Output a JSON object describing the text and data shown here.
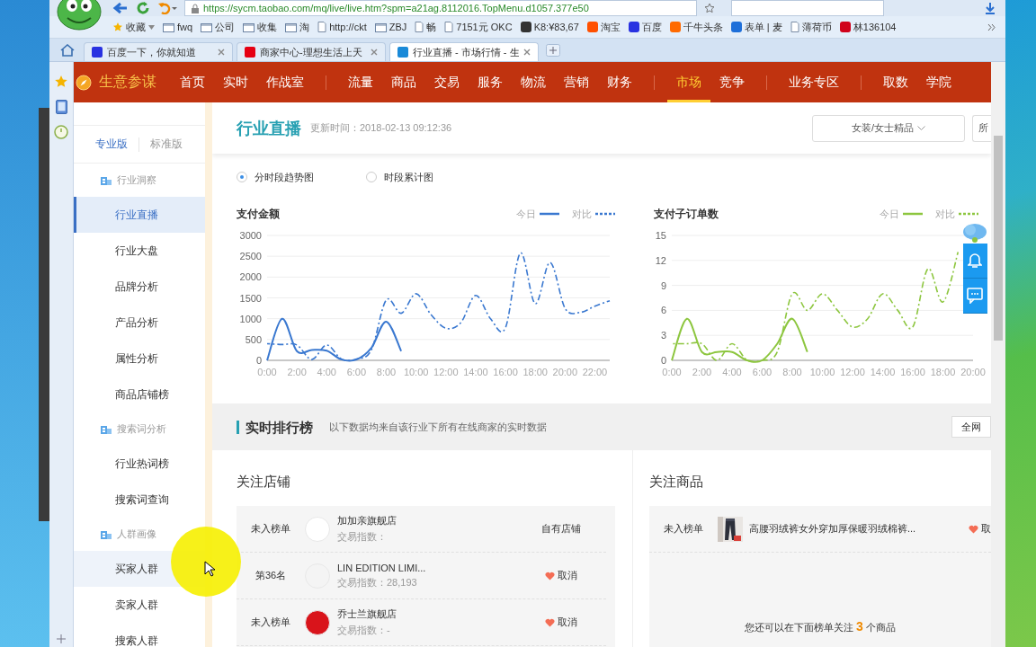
{
  "browser": {
    "address": "https://sycm.taobao.com/mq/live/live.htm?spm=a21ag.8112016.TopMenu.d1057.377e50",
    "bookmarks": [
      {
        "label": "收藏",
        "kind": "star"
      },
      {
        "label": "fwq",
        "kind": "folder"
      },
      {
        "label": "公司",
        "kind": "folder"
      },
      {
        "label": "收集",
        "kind": "folder"
      },
      {
        "label": "淘",
        "kind": "folder"
      },
      {
        "label": "http://ckt",
        "kind": "page"
      },
      {
        "label": "ZBJ",
        "kind": "folder"
      },
      {
        "label": "畅",
        "kind": "page"
      },
      {
        "label": "7151元 OKC",
        "kind": "page"
      },
      {
        "label": "K8:¥83,67",
        "kind": "logo",
        "color": "#333333"
      },
      {
        "label": "淘宝",
        "kind": "logo",
        "color": "#ff5000"
      },
      {
        "label": "百度",
        "kind": "logo",
        "color": "#2932e1"
      },
      {
        "label": "千牛头条",
        "kind": "logo",
        "color": "#ff6a00"
      },
      {
        "label": "表单 | 麦",
        "kind": "logo",
        "color": "#1e6fd9"
      },
      {
        "label": "薄荷币",
        "kind": "page"
      },
      {
        "label": "林136104",
        "kind": "logo",
        "color": "#d0021b"
      }
    ],
    "tabs": [
      {
        "title": "百度一下，你就知道",
        "color": "#2932e1",
        "selected": false
      },
      {
        "title": "商家中心-理想生活上天",
        "color": "#e60012",
        "selected": false
      },
      {
        "title": "行业直播 - 市场行情 - 生",
        "color": "#1a8ad8",
        "selected": true
      }
    ]
  },
  "nav": {
    "brand": "生意参谋",
    "groups": [
      [
        {
          "label": "首页",
          "selected": false
        },
        {
          "label": "实时",
          "selected": false
        },
        {
          "label": "作战室",
          "selected": false
        }
      ],
      [
        {
          "label": "流量",
          "selected": false
        },
        {
          "label": "商品",
          "selected": false
        },
        {
          "label": "交易",
          "selected": false
        },
        {
          "label": "服务",
          "selected": false
        },
        {
          "label": "物流",
          "selected": false
        },
        {
          "label": "营销",
          "selected": false
        },
        {
          "label": "财务",
          "selected": false
        }
      ],
      [
        {
          "label": "市场",
          "selected": true
        },
        {
          "label": "竞争",
          "selected": false
        }
      ],
      [
        {
          "label": "业务专区",
          "selected": false
        }
      ],
      [
        {
          "label": "取数",
          "selected": false
        },
        {
          "label": "学院",
          "selected": false
        }
      ]
    ]
  },
  "sidebar": {
    "versions": [
      {
        "label": "专业版",
        "selected": true
      },
      {
        "label": "标准版",
        "selected": false
      }
    ],
    "sections": [
      {
        "title": "行业洞察",
        "items": [
          {
            "label": "行业直播",
            "selected": true,
            "hovered": false
          },
          {
            "label": "行业大盘",
            "selected": false,
            "hovered": false
          },
          {
            "label": "品牌分析",
            "selected": false,
            "hovered": false
          },
          {
            "label": "产品分析",
            "selected": false,
            "hovered": false
          },
          {
            "label": "属性分析",
            "selected": false,
            "hovered": false
          },
          {
            "label": "商品店铺榜",
            "selected": false,
            "hovered": false
          }
        ]
      },
      {
        "title": "搜索词分析",
        "items": [
          {
            "label": "行业热词榜",
            "selected": false,
            "hovered": false
          },
          {
            "label": "搜索词查询",
            "selected": false,
            "hovered": false
          }
        ]
      },
      {
        "title": "人群画像",
        "items": [
          {
            "label": "买家人群",
            "selected": false,
            "hovered": true
          },
          {
            "label": "卖家人群",
            "selected": false,
            "hovered": false
          },
          {
            "label": "搜索人群",
            "selected": false,
            "hovered": false
          }
        ]
      }
    ]
  },
  "header": {
    "title": "行业直播",
    "updated": "更新时间：2018-02-13 09:12:36",
    "category": "女装/女士精品",
    "button_2": "所"
  },
  "views": [
    {
      "label": "分时段趋势图",
      "selected": true
    },
    {
      "label": "时段累计图",
      "selected": false
    }
  ],
  "charts": [
    {
      "title": "支付金额",
      "chart_data": {
        "type": "line",
        "grid": true,
        "legend": true,
        "x": [
          0,
          1,
          2,
          3,
          4,
          5,
          6,
          7,
          8,
          9,
          10,
          11,
          12,
          13,
          14,
          15,
          16,
          17,
          18,
          19,
          20,
          21,
          22,
          23
        ],
        "xlim": [
          0,
          23
        ],
        "ylim": [
          0,
          3000
        ],
        "xticks": [
          {
            "value": 0,
            "label": "0:00"
          },
          {
            "value": 2,
            "label": "2:00"
          },
          {
            "value": 4,
            "label": "4:00"
          },
          {
            "value": 6,
            "label": "6:00"
          },
          {
            "value": 8,
            "label": "8:00"
          },
          {
            "value": 10,
            "label": "10:00"
          },
          {
            "value": 12,
            "label": "12:00"
          },
          {
            "value": 14,
            "label": "14:00"
          },
          {
            "value": 16,
            "label": "16:00"
          },
          {
            "value": 18,
            "label": "18:00"
          },
          {
            "value": 20,
            "label": "20:00"
          },
          {
            "value": 22,
            "label": "22:00"
          }
        ],
        "yticks": [
          0,
          500,
          1000,
          1500,
          2000,
          2500,
          3000
        ],
        "series": [
          {
            "name": "今日",
            "color": "#3a78d0",
            "line_style": "solid",
            "values": [
              0,
              1000,
              220,
              250,
              230,
              20,
              20,
              300,
              930,
              220,
              null,
              null,
              null,
              null,
              null,
              null,
              null,
              null,
              null,
              null,
              null,
              null,
              null,
              null
            ]
          },
          {
            "name": "对比",
            "color": "#3a78d0",
            "line_style": "dash-dot",
            "values": [
              400,
              380,
              370,
              20,
              370,
              30,
              30,
              250,
              1450,
              1130,
              1600,
              1100,
              770,
              900,
              1560,
              1000,
              780,
              2580,
              1360,
              2350,
              1250,
              1150,
              1300,
              1430
            ]
          }
        ]
      }
    },
    {
      "title": "支付子订单数",
      "chart_data": {
        "type": "line",
        "grid": true,
        "legend": true,
        "x": [
          0,
          1,
          2,
          3,
          4,
          5,
          6,
          7,
          8,
          9,
          10,
          11,
          12,
          13,
          14,
          15,
          16,
          17,
          18,
          19
        ],
        "xlim": [
          0,
          20
        ],
        "ylim": [
          0,
          15
        ],
        "xticks": [
          {
            "value": 0,
            "label": "0:00"
          },
          {
            "value": 2,
            "label": "2:00"
          },
          {
            "value": 4,
            "label": "4:00"
          },
          {
            "value": 6,
            "label": "6:00"
          },
          {
            "value": 8,
            "label": "8:00"
          },
          {
            "value": 10,
            "label": "10:00"
          },
          {
            "value": 12,
            "label": "12:00"
          },
          {
            "value": 14,
            "label": "14:00"
          },
          {
            "value": 16,
            "label": "16:00"
          },
          {
            "value": 18,
            "label": "18:00"
          },
          {
            "value": 20,
            "label": "20:00"
          }
        ],
        "yticks": [
          0,
          3,
          6,
          9,
          12,
          15
        ],
        "series": [
          {
            "name": "今日",
            "color": "#8dc63f",
            "line_style": "solid",
            "values": [
              0,
              5,
              1,
              1,
              1,
              0,
              0,
              2,
              5,
              1,
              null,
              null,
              null,
              null,
              null,
              null,
              null,
              null,
              null,
              null
            ]
          },
          {
            "name": "对比",
            "color": "#8dc63f",
            "line_style": "dash-dot",
            "values": [
              2,
              2,
              2,
              0,
              2,
              0,
              0,
              1,
              8,
              6,
              8,
              6,
              4,
              5,
              8,
              6,
              4,
              11,
              7,
              13
            ]
          }
        ]
      }
    }
  ],
  "ranking": {
    "title": "实时排行榜",
    "description": "以下数据均来自该行业下所有在线商家的实时数据",
    "scope": "全网",
    "shops": {
      "title": "关注店铺",
      "rows": [
        {
          "rank": "未入榜单",
          "name": "加加亲旗舰店",
          "index": "交易指数：",
          "action": "自有店铺",
          "followed": false,
          "color": "#ffffff"
        },
        {
          "rank": "第36名",
          "name": "LIN EDITION LIMI...",
          "index": "交易指数：28,193",
          "action": "取消",
          "followed": true,
          "color": "#f4f4f4"
        },
        {
          "rank": "未入榜单",
          "name": "乔士兰旗舰店",
          "index": "交易指数：-",
          "action": "取消",
          "followed": true,
          "color": "#d9141b"
        }
      ]
    },
    "products": {
      "title": "关注商品",
      "rows": [
        {
          "rank": "未入榜单",
          "name": "高腰羽绒裤女外穿加厚保暖羽绒棉裤...",
          "action": "取",
          "followed": true,
          "kind": "picture"
        }
      ],
      "note": "您还可以在下面榜单关注 **3** 个商品"
    }
  }
}
